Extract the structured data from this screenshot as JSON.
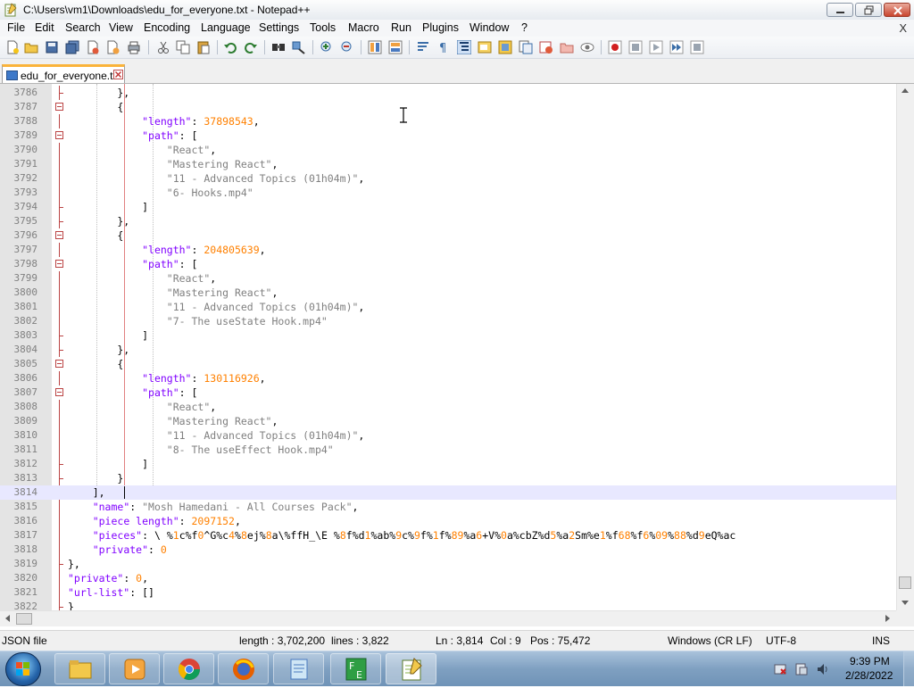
{
  "window": {
    "title": "C:\\Users\\vm1\\Downloads\\edu_for_everyone.txt - Notepad++"
  },
  "menu": [
    "File",
    "Edit",
    "Search",
    "View",
    "Encoding",
    "Language",
    "Settings",
    "Tools",
    "Macro",
    "Run",
    "Plugins",
    "Window",
    "?"
  ],
  "menu_close": "X",
  "tab": {
    "label": "edu_for_everyone.txt"
  },
  "editor": {
    "current_line": 3814,
    "lines": [
      {
        "n": "3786",
        "text": "        },"
      },
      {
        "n": "3787",
        "text": "        {"
      },
      {
        "n": "3788",
        "text": "            \"length\": 37898543,"
      },
      {
        "n": "3789",
        "text": "            \"path\": ["
      },
      {
        "n": "3790",
        "text": "                \"React\","
      },
      {
        "n": "3791",
        "text": "                \"Mastering React\","
      },
      {
        "n": "3792",
        "text": "                \"11 - Advanced Topics (01h04m)\","
      },
      {
        "n": "3793",
        "text": "                \"6- Hooks.mp4\""
      },
      {
        "n": "3794",
        "text": "            ]"
      },
      {
        "n": "3795",
        "text": "        },"
      },
      {
        "n": "3796",
        "text": "        {"
      },
      {
        "n": "3797",
        "text": "            \"length\": 204805639,"
      },
      {
        "n": "3798",
        "text": "            \"path\": ["
      },
      {
        "n": "3799",
        "text": "                \"React\","
      },
      {
        "n": "3800",
        "text": "                \"Mastering React\","
      },
      {
        "n": "3801",
        "text": "                \"11 - Advanced Topics (01h04m)\","
      },
      {
        "n": "3802",
        "text": "                \"7- The useState Hook.mp4\""
      },
      {
        "n": "3803",
        "text": "            ]"
      },
      {
        "n": "3804",
        "text": "        },"
      },
      {
        "n": "3805",
        "text": "        {"
      },
      {
        "n": "3806",
        "text": "            \"length\": 130116926,"
      },
      {
        "n": "3807",
        "text": "            \"path\": ["
      },
      {
        "n": "3808",
        "text": "                \"React\","
      },
      {
        "n": "3809",
        "text": "                \"Mastering React\","
      },
      {
        "n": "3810",
        "text": "                \"11 - Advanced Topics (01h04m)\","
      },
      {
        "n": "3811",
        "text": "                \"8- The useEffect Hook.mp4\""
      },
      {
        "n": "3812",
        "text": "            ]"
      },
      {
        "n": "3813",
        "text": "        }"
      },
      {
        "n": "3814",
        "text": "    ],"
      },
      {
        "n": "3815",
        "text": "    \"name\": \"Mosh Hamedani - All Courses Pack\","
      },
      {
        "n": "3816",
        "text": "    \"piece length\": 2097152,"
      },
      {
        "n": "3817",
        "text": "    \"pieces\": \"\\\" %1c%f0^G%c4%8ej%8a\\\"%ffH_\\\"E %8f%d1%ab%9c%9f%1f%89%a6+V%0a%cbZ%d5%a2Sm%e1%f68%f6%09%88%d9eQ%ac"
      },
      {
        "n": "3818",
        "text": "    \"private\": 0"
      },
      {
        "n": "3819",
        "text": "},"
      },
      {
        "n": "3820",
        "text": "\"private\": 0,"
      },
      {
        "n": "3821",
        "text": "\"url-list\": []"
      },
      {
        "n": "3822",
        "text": "}"
      }
    ]
  },
  "status": {
    "file_type": "JSON file",
    "length": "length : 3,702,200",
    "lines": "lines : 3,822",
    "ln": "Ln : 3,814",
    "col": "Col : 9",
    "pos": "Pos : 75,472",
    "eol": "Windows (CR LF)",
    "encoding": "UTF-8",
    "mode": "INS"
  },
  "taskbar": {
    "time": "9:39 PM",
    "date": "2/28/2022"
  }
}
